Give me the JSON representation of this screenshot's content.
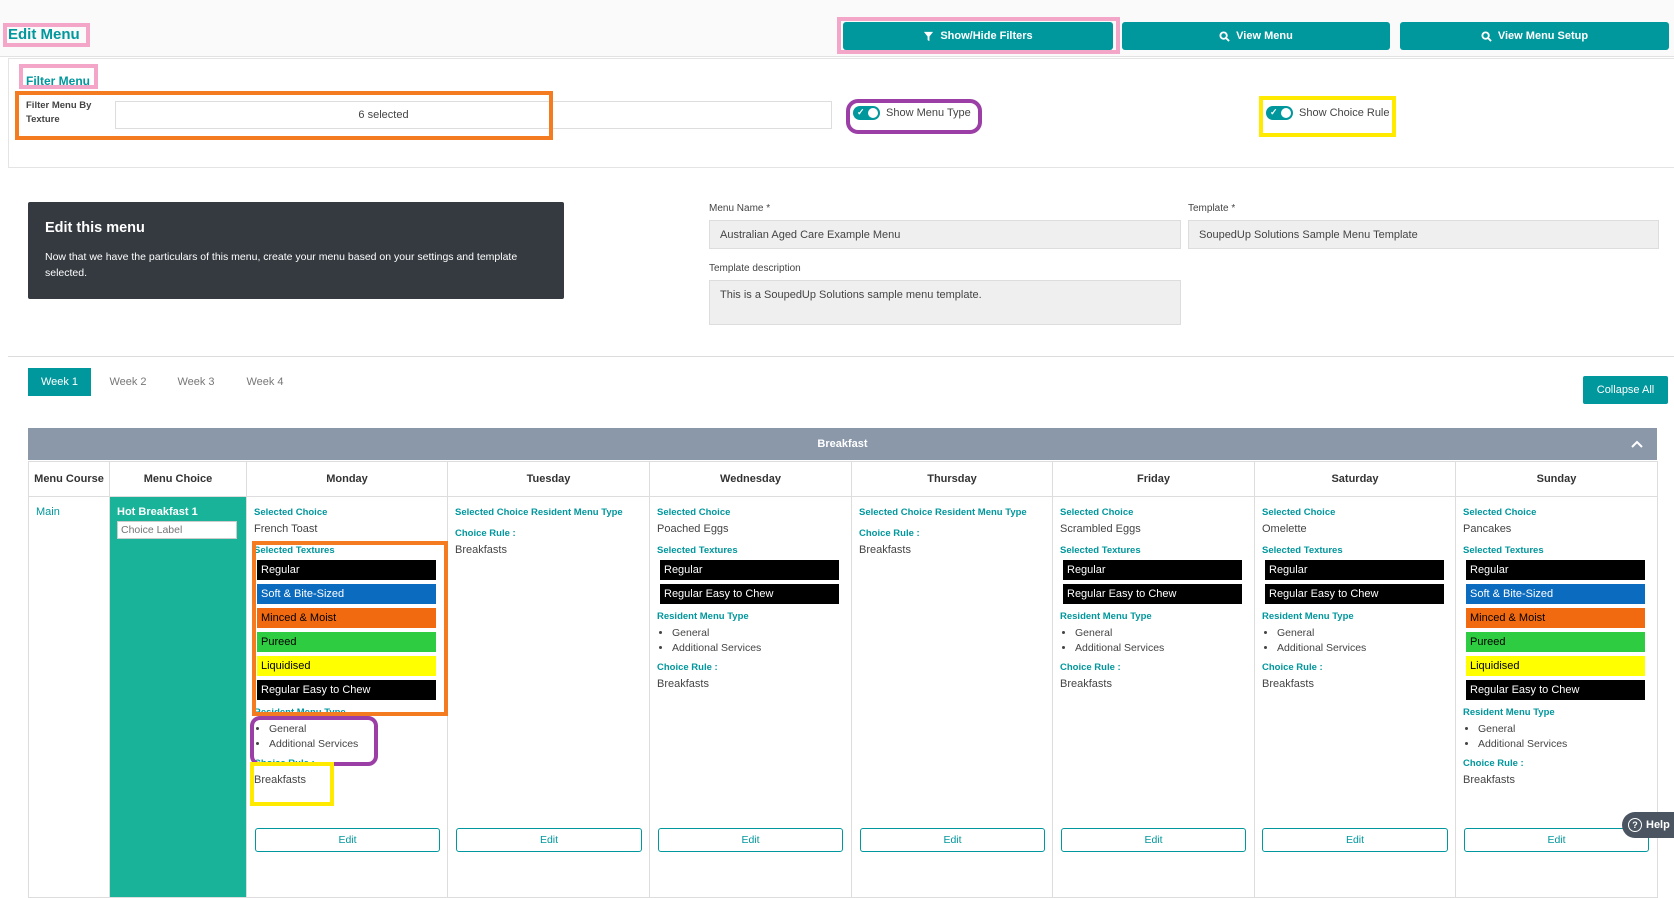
{
  "page": {
    "title": "Edit Menu"
  },
  "toolbar": {
    "filters_label": "Show/Hide Filters",
    "view_menu_label": "View Menu",
    "view_setup_label": "View Menu Setup"
  },
  "filter": {
    "title": "Filter Menu",
    "texture_label": "Filter Menu By Texture",
    "texture_value": "6 selected",
    "show_menu_type": "Show Menu Type",
    "show_choice_rule": "Show Choice Rule"
  },
  "info": {
    "heading": "Edit this menu",
    "text": "Now that we have the particulars of this menu, create your menu based on your settings and template selected."
  },
  "form": {
    "menu_name_label": "Menu Name *",
    "menu_name": "Australian Aged Care Example Menu",
    "template_label": "Template *",
    "template": "SoupedUp Solutions Sample Menu Template",
    "desc_label": "Template description",
    "desc": "This is a SoupedUp Solutions sample menu template."
  },
  "tabs": [
    "Week 1",
    "Week 2",
    "Week 3",
    "Week 4"
  ],
  "collapse_label": "Collapse All",
  "section": {
    "title": "Breakfast",
    "chevron": "chevron-up-icon"
  },
  "columns": [
    "Menu Course",
    "Menu Choice",
    "Monday",
    "Tuesday",
    "Wednesday",
    "Thursday",
    "Friday",
    "Saturday",
    "Sunday"
  ],
  "row": {
    "course": "Main",
    "choice": "Hot Breakfast 1",
    "choice_placeholder": "Choice Label"
  },
  "labels": {
    "selected_choice": "Selected Choice",
    "selected_choice_rmt": "Selected Choice Resident Menu Type",
    "selected_textures": "Selected Textures",
    "resident_menu_type": "Resident Menu Type",
    "choice_rule": "Choice Rule :",
    "edit": "Edit"
  },
  "days": {
    "monday": {
      "choice": "French Toast",
      "textures": [
        "Regular",
        "Soft & Bite-Sized",
        "Minced & Moist",
        "Pureed",
        "Liquidised",
        "Regular Easy to Chew"
      ],
      "types": [
        "General",
        "Additional Services"
      ],
      "rule": "Breakfasts"
    },
    "tuesday": {
      "rule": "Breakfasts"
    },
    "wednesday": {
      "choice": "Poached Eggs",
      "textures": [
        "Regular",
        "Regular Easy to Chew"
      ],
      "types": [
        "General",
        "Additional Services"
      ],
      "rule": "Breakfasts"
    },
    "thursday": {
      "rule": "Breakfasts"
    },
    "friday": {
      "choice": "Scrambled Eggs",
      "textures": [
        "Regular",
        "Regular Easy to Chew"
      ],
      "types": [
        "General",
        "Additional Services"
      ],
      "rule": "Breakfasts"
    },
    "saturday": {
      "choice": "Omelette",
      "textures": [
        "Regular",
        "Regular Easy to Chew"
      ],
      "types": [
        "General",
        "Additional Services"
      ],
      "rule": "Breakfasts"
    },
    "sunday": {
      "choice": "Pancakes",
      "textures": [
        "Regular",
        "Soft & Bite-Sized",
        "Minced & Moist",
        "Pureed",
        "Liquidised",
        "Regular Easy to Chew"
      ],
      "types": [
        "General",
        "Additional Services"
      ],
      "rule": "Breakfasts"
    }
  },
  "colors": {
    "accent": "#00979d",
    "regular": "#000000",
    "soft": "#0b6bbf",
    "minced": "#f26a0f",
    "pureed": "#2ecc40",
    "liquidised": "#ffff00"
  },
  "help_label": "Help"
}
